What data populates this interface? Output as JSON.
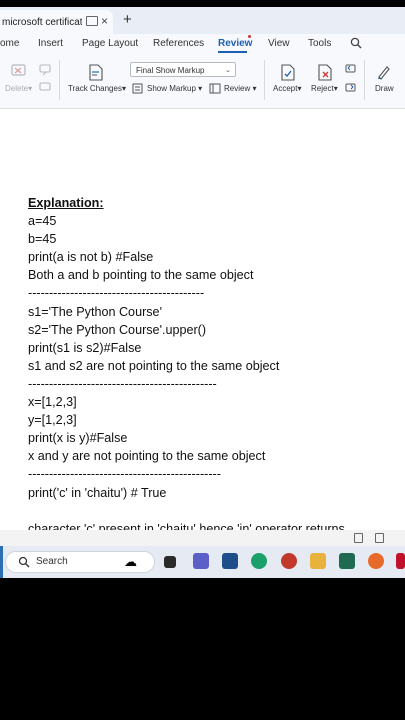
{
  "tab": {
    "title": "microsoft certification",
    "new_tab": "+",
    "close": "×"
  },
  "ribbon_tabs": {
    "home": "ome",
    "insert": "Insert",
    "page_layout": "Page Layout",
    "references": "References",
    "review": "Review",
    "view": "View",
    "tools": "Tools"
  },
  "ribbon": {
    "delete_label": "Delete",
    "track_changes_label": "Track Changes",
    "show_markup_select": "Final Show Markup",
    "show_markup_label": "Show Markup",
    "review_label": "Review",
    "accept_label": "Accept",
    "reject_label": "Reject",
    "draw_label": "Draw",
    "dropdown_caret": "▾"
  },
  "document": {
    "lines": [
      {
        "text": "Explanation:",
        "style": "heading"
      },
      {
        "text": "a=45"
      },
      {
        "text": "b=45"
      },
      {
        "text": "print(a is not b) #False"
      },
      {
        "text": "Both a and b pointing to the same object"
      },
      {
        "text": "------------------------------------------"
      },
      {
        "text": "s1='The Python Course'"
      },
      {
        "text": "s2='The Python Course'.upper()"
      },
      {
        "text": "print(s1 is s2)#False"
      },
      {
        "text": "s1 and s2 are not pointing to the same object"
      },
      {
        "text": "---------------------------------------------"
      },
      {
        "text": "x=[1,2,3]"
      },
      {
        "text": "y=[1,2,3]"
      },
      {
        "text": "print(x is y)#False"
      },
      {
        "text": "x and y are not pointing to the same object"
      },
      {
        "text": "----------------------------------------------"
      },
      {
        "text": "print('c' in 'chaitu') # True"
      },
      {
        "text": ""
      },
      {
        "text": "character 'c' present in 'chaitu' hence 'in' operator returns"
      }
    ]
  },
  "taskbar": {
    "search_label": "Search"
  },
  "colors": {
    "accent": "#1d5fb3",
    "ribbon_bg": "#f7f9fc",
    "tabbar_bg": "#e9eef6",
    "taskbar_bg": "#e6ebf3"
  }
}
